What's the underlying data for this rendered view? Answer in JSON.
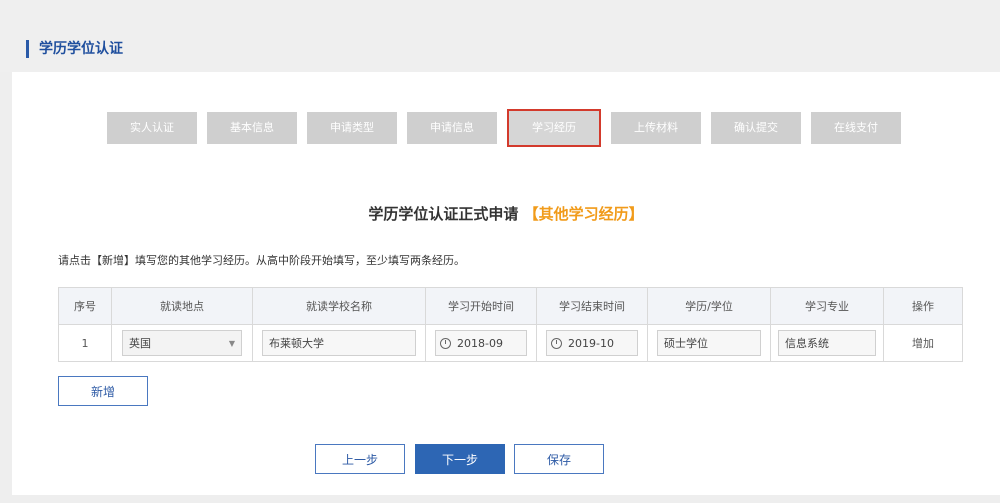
{
  "header": {
    "title": "学历学位认证"
  },
  "steps": [
    "实人认证",
    "基本信息",
    "申请类型",
    "申请信息",
    "学习经历",
    "上传材料",
    "确认提交",
    "在线支付"
  ],
  "active_step_index": 4,
  "form": {
    "title": "学历学位认证正式申请",
    "subtitle": "【其他学习经历】",
    "instruction": "请点击【新增】填写您的其他学习经历。从高中阶段开始填写，至少填写两条经历。"
  },
  "table": {
    "headers": [
      "序号",
      "就读地点",
      "就读学校名称",
      "学习开始时间",
      "学习结束时间",
      "学历/学位",
      "学习专业",
      "操作"
    ],
    "rows": [
      {
        "index": "1",
        "location": "英国",
        "school": "布莱顿大学",
        "start": "2018-09",
        "end": "2019-10",
        "degree": "硕士学位",
        "major": "信息系统",
        "action": "增加"
      }
    ]
  },
  "buttons": {
    "add": "新增",
    "prev": "上一步",
    "next": "下一步",
    "save": "保存"
  },
  "colors": {
    "accent": "#2d66b4",
    "highlight": "#f19b1a",
    "active_step_border": "#d33a2c"
  }
}
